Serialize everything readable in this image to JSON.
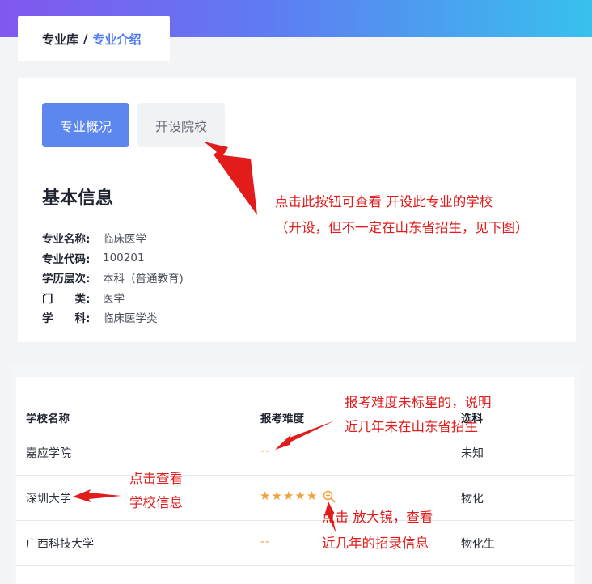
{
  "breadcrumb": {
    "root": "专业库",
    "separator": "/",
    "current": "专业介绍"
  },
  "tabs": [
    {
      "label": "专业概况",
      "active": true
    },
    {
      "label": "开设院校",
      "active": false
    }
  ],
  "section_title": "基本信息",
  "info": [
    {
      "key": "专业名称:",
      "value": "临床医学"
    },
    {
      "key": "专业代码:",
      "value": "100201"
    },
    {
      "key": "学历层次:",
      "value": "本科（普通教育)"
    },
    {
      "key": "门　　类:",
      "value": "医学"
    },
    {
      "key": "学　　科:",
      "value": "临床医学类"
    }
  ],
  "notes": {
    "tab_note_line1": "点击此按钮可查看 开设此专业的学校",
    "tab_note_line2": "（开设，但不一定在山东省招生，见下图）",
    "difficulty_note_line1": "报考难度未标星的，说明",
    "difficulty_note_line2": "近几年未在山东省招生",
    "school_note_line1": "点击查看",
    "school_note_line2": "学校信息",
    "zoom_note_line1": "点击  放大镜，查看",
    "zoom_note_line2": "近几年的招录信息"
  },
  "table": {
    "headers": {
      "school": "学校名称",
      "difficulty": "报考难度",
      "subject": "选科"
    },
    "rows": [
      {
        "school": "嘉应学院",
        "difficulty": "--",
        "stars": 0,
        "subject": "未知"
      },
      {
        "school": "深圳大学",
        "difficulty": "",
        "stars": 5,
        "subject": "物化"
      },
      {
        "school": "广西科技大学",
        "difficulty": "--",
        "stars": 0,
        "subject": "物化生"
      }
    ]
  },
  "colors": {
    "accent": "#5b87ef",
    "annotation": "#e21b1b",
    "star": "#f0a23e",
    "breadcrumb_current": "#4f7cf0"
  },
  "icons": {
    "zoom": "zoom-in-icon",
    "star": "star-icon"
  }
}
